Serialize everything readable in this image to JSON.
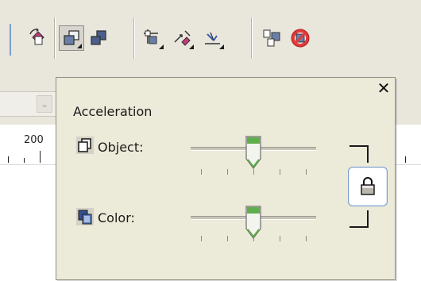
{
  "ruler": {
    "label": "200"
  },
  "toolbar": {
    "buttons": [
      {
        "icon": "rotate-page-icon"
      },
      {
        "icon": "bring-to-front-icon",
        "active": true,
        "has_flyout": true
      },
      {
        "icon": "send-to-back-icon"
      },
      {
        "icon": "transform-icon",
        "has_flyout": true
      },
      {
        "icon": "align-icon",
        "has_flyout": true
      },
      {
        "icon": "skew-icon",
        "has_flyout": true
      },
      {
        "icon": "copy-properties-icon"
      },
      {
        "icon": "no-entry-icon"
      }
    ]
  },
  "popup": {
    "close_glyph": "✕",
    "title": "Acceleration",
    "rows": [
      {
        "label": "Object:",
        "icon": "object-accel-icon",
        "value": 0.5
      },
      {
        "label": "Color:",
        "icon": "color-accel-icon",
        "value": 0.5
      }
    ],
    "lock": {
      "icon": "lock-icon",
      "locked": true
    }
  },
  "colors": {
    "panel": "#ecead8",
    "toolbar": "#e9e6dc",
    "thumb_green": "#5fae4c",
    "lock_border": "#7a9fcc"
  }
}
